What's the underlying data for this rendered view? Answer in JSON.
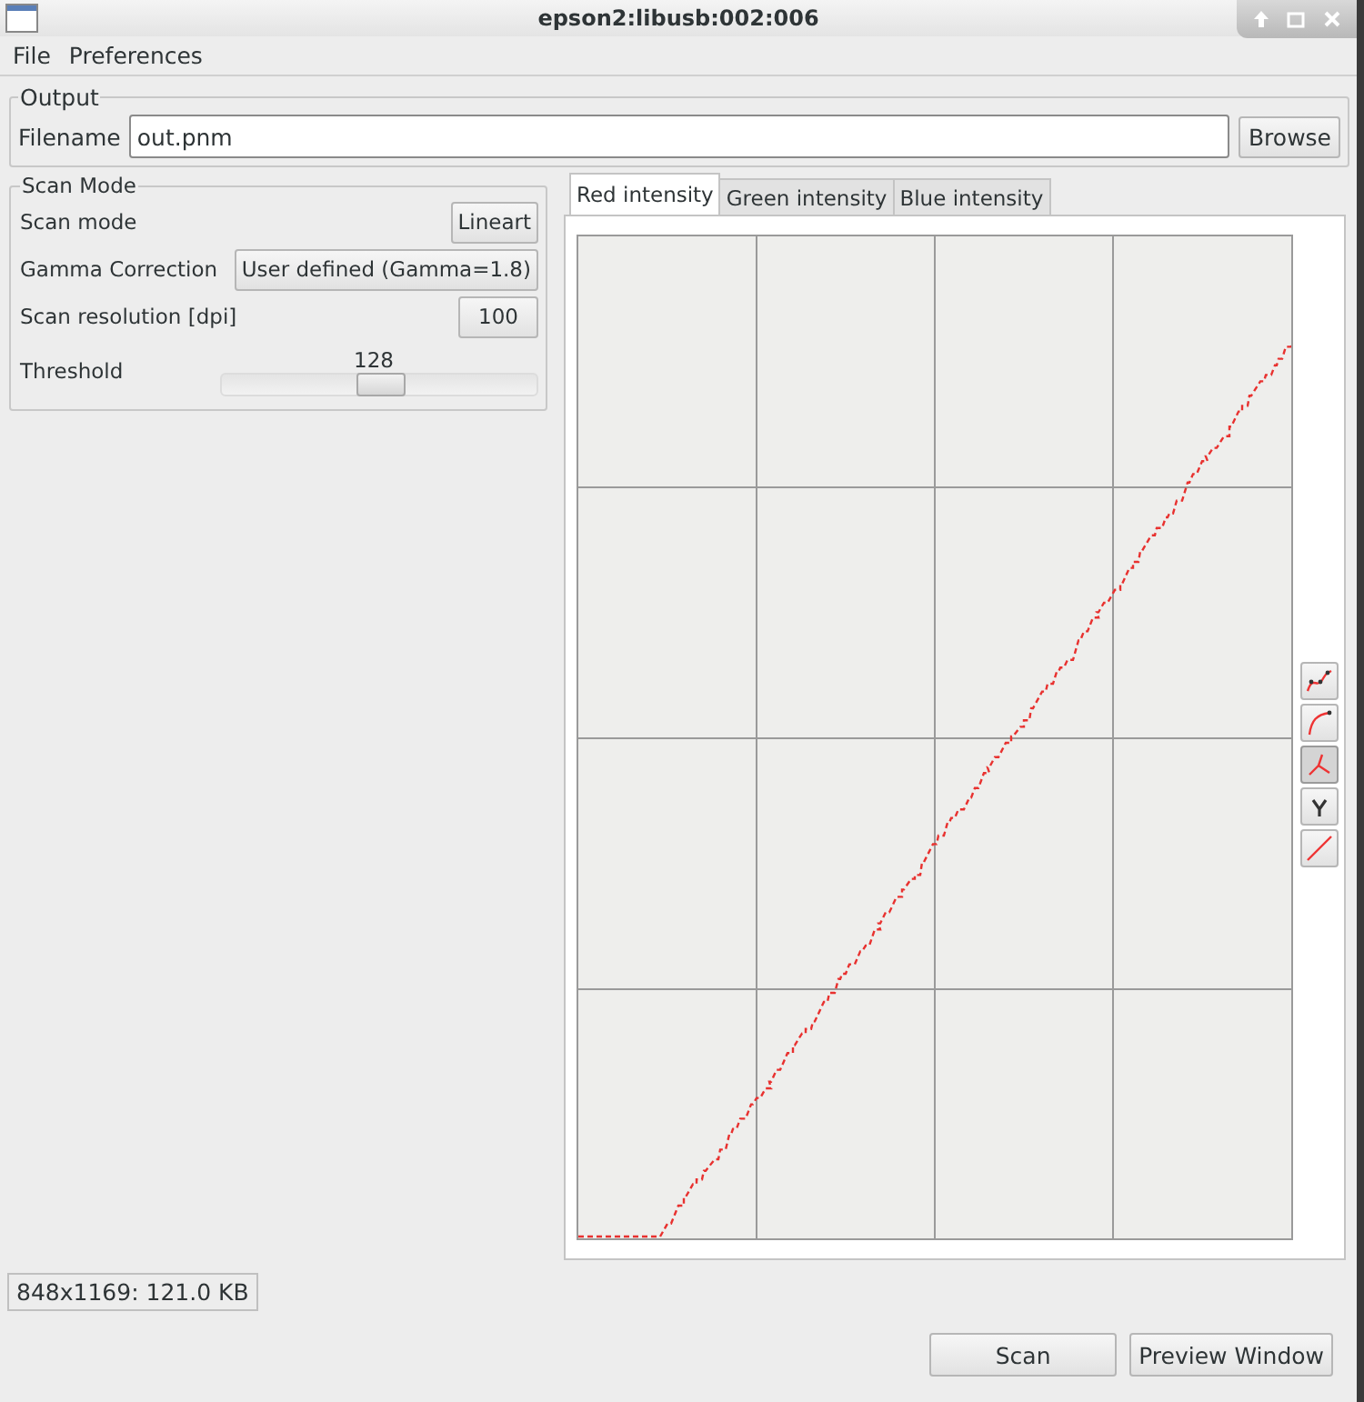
{
  "window": {
    "title": "epson2:libusb:002:006"
  },
  "menu": [
    "File",
    "Preferences"
  ],
  "output": {
    "title": "Output",
    "filename_label": "Filename",
    "filename_value": "out.pnm",
    "browse_button": "Browse"
  },
  "scan_mode": {
    "title": "Scan Mode",
    "rows": [
      {
        "kind": "button",
        "label": "Scan mode",
        "value": "Lineart"
      },
      {
        "kind": "button",
        "label": "Gamma Correction",
        "value": "User defined (Gamma=1.8)"
      },
      {
        "kind": "spin",
        "label": "Scan resolution [dpi]",
        "value": "100"
      },
      {
        "kind": "slider",
        "label": "Threshold",
        "value": "128",
        "level": 0.5
      }
    ]
  },
  "curve_tabs": [
    {
      "label": "Red intensity",
      "selected": true
    },
    {
      "label": "Green intensity",
      "selected": false
    },
    {
      "label": "Blue intensity",
      "selected": false
    }
  ],
  "curve_tools": [
    {
      "kind": "spline",
      "selected": false
    },
    {
      "kind": "smooth",
      "selected": false
    },
    {
      "kind": "freehand",
      "selected": true
    },
    {
      "kind": "gamma",
      "selected": false
    },
    {
      "kind": "linear",
      "selected": false
    }
  ],
  "status": "848x1169: 121.0 KB",
  "buttons": [
    "Scan",
    "Preview Window"
  ]
}
